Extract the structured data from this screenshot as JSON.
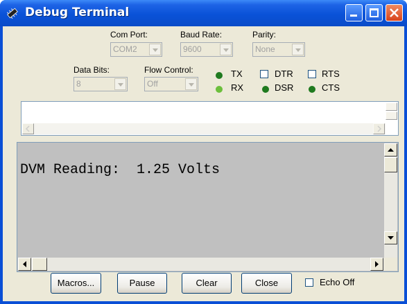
{
  "window": {
    "title": "Debug Terminal"
  },
  "settings": {
    "com_port": {
      "label": "Com Port:",
      "value": "COM2"
    },
    "baud_rate": {
      "label": "Baud Rate:",
      "value": "9600"
    },
    "parity": {
      "label": "Parity:",
      "value": "None"
    },
    "data_bits": {
      "label": "Data Bits:",
      "value": "8"
    },
    "flow_control": {
      "label": "Flow Control:",
      "value": "Off"
    }
  },
  "indicators": {
    "tx": {
      "label": "TX",
      "color": "#1f7a1f"
    },
    "rx": {
      "label": "RX",
      "color": "#6cbf3c"
    },
    "dsr": {
      "label": "DSR",
      "color": "#1f7a1f"
    },
    "cts": {
      "label": "CTS",
      "color": "#1f7a1f"
    }
  },
  "checkboxes": {
    "dtr": {
      "label": "DTR",
      "checked": false
    },
    "rts": {
      "label": "RTS",
      "checked": false
    },
    "echo_off": {
      "label": "Echo Off",
      "checked": false
    }
  },
  "terminal": {
    "text": "DVM Reading:  1.25 Volts"
  },
  "buttons": {
    "macros": "Macros...",
    "pause": "Pause",
    "clear": "Clear",
    "close": "Close"
  },
  "icons": {
    "title": "chip-icon"
  }
}
